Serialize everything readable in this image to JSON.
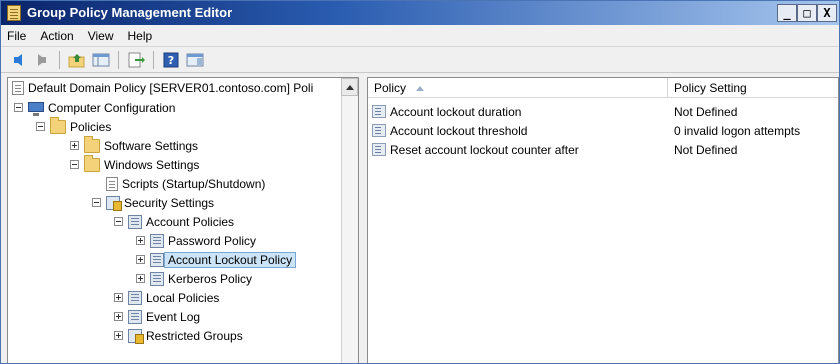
{
  "window": {
    "title": "Group Policy Management Editor",
    "controls": [
      "_",
      "□",
      "X"
    ]
  },
  "menu": [
    "File",
    "Action",
    "View",
    "Help"
  ],
  "toolbar": {
    "buttons": [
      "back-arrow-icon",
      "forward-arrow-icon",
      "up-folder-icon",
      "show-hide-tree-icon",
      "export-list-icon",
      "help-icon",
      "properties-pane-icon"
    ]
  },
  "tree": {
    "header": "Default Domain Policy [SERVER01.contoso.com] Poli",
    "items": [
      {
        "label": "Computer Configuration"
      },
      {
        "label": "Policies"
      },
      {
        "label": "Software Settings"
      },
      {
        "label": "Windows Settings"
      },
      {
        "label": "Scripts (Startup/Shutdown)"
      },
      {
        "label": "Security Settings"
      },
      {
        "label": "Account Policies"
      },
      {
        "label": "Password Policy"
      },
      {
        "label": "Account Lockout Policy"
      },
      {
        "label": "Kerberos Policy"
      },
      {
        "label": "Local Policies"
      },
      {
        "label": "Event Log"
      },
      {
        "label": "Restricted Groups"
      }
    ]
  },
  "list": {
    "columns": [
      "Policy",
      "Policy Setting"
    ],
    "rows": [
      {
        "policy": "Account lockout duration",
        "setting": "Not Defined"
      },
      {
        "policy": "Account lockout threshold",
        "setting": "0 invalid logon attempts"
      },
      {
        "policy": "Reset account lockout counter after",
        "setting": "Not Defined"
      }
    ]
  }
}
